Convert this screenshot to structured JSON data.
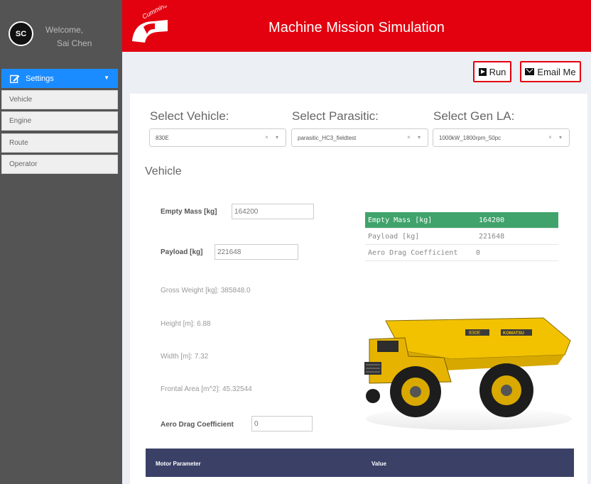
{
  "user": {
    "avatar_initials": "SC",
    "welcome": "Welcome,",
    "name": "Sai Chen"
  },
  "sidebar": {
    "settings_label": "Settings",
    "items": [
      {
        "label": "Vehicle"
      },
      {
        "label": "Engine"
      },
      {
        "label": "Route"
      },
      {
        "label": "Operator"
      }
    ]
  },
  "header": {
    "title": "Machine Mission Simulation",
    "logo_text": "Cummins",
    "brand_color": "#e3000f"
  },
  "toolbar": {
    "run_label": "Run",
    "email_label": "Email Me"
  },
  "selects": {
    "vehicle": {
      "label": "Select Vehicle:",
      "value": "830E"
    },
    "parasitic": {
      "label": "Select Parasitic:",
      "value": "parasitic_HC3_fieldtest"
    },
    "gen_la": {
      "label": "Select Gen LA:",
      "value": "1000kW_1800rpm_50pc"
    }
  },
  "vehicle": {
    "section_title": "Vehicle",
    "empty_mass_label": "Empty Mass [kg]",
    "empty_mass_value": "164200",
    "payload_label": "Payload [kg]",
    "payload_value": "221648",
    "gross_weight": "Gross Weight [kg]: 385848.0",
    "height": "Height [m]: 6.88",
    "width": "Width [m]: 7.32",
    "frontal_area": "Frontal Area [m^2]: 45.32544",
    "aero_label": "Aero Drag Coefficient",
    "aero_value": "0"
  },
  "summary": [
    {
      "key": "Empty Mass [kg]",
      "value": "164200"
    },
    {
      "key": "Payload [kg]",
      "value": "221648"
    },
    {
      "key": "Aero Drag Coefficient",
      "value": "0"
    }
  ],
  "truck": {
    "model_badge": "830E",
    "brand_badge": "KOMATSU"
  },
  "motor_table": {
    "col_param": "Motor Parameter",
    "col_value": "Value"
  }
}
